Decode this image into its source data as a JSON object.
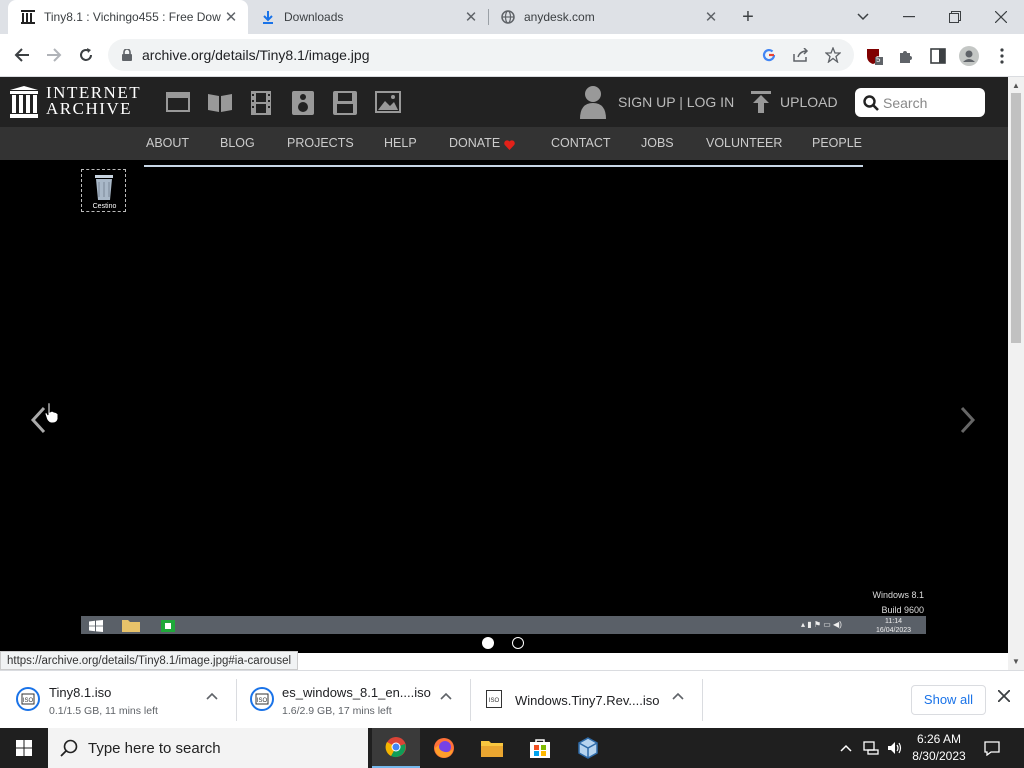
{
  "browser": {
    "tabs": [
      {
        "title": "Tiny8.1 : Vichingo455 : Free Dow",
        "icon": "internet-archive-icon",
        "active": true
      },
      {
        "title": "Downloads",
        "icon": "download-icon",
        "active": false
      },
      {
        "title": "anydesk.com",
        "icon": "globe-icon",
        "active": false
      }
    ],
    "new_tab_label": "+",
    "url": "archive.org/details/Tiny8.1/image.jpg",
    "extension_badge": "5",
    "status_url": "https://archive.org/details/Tiny8.1/image.jpg#ia-carousel"
  },
  "archive": {
    "logo_line1": "INTERNET",
    "logo_line2": "ARCHIVE",
    "signup": "SIGN UP | LOG IN",
    "upload": "UPLOAD",
    "search_placeholder": "Search",
    "nav": [
      "ABOUT",
      "BLOG",
      "PROJECTS",
      "HELP",
      "DONATE",
      "CONTACT",
      "JOBS",
      "VOLUNTEER",
      "PEOPLE"
    ]
  },
  "viewer": {
    "recycle_label": "Cestino",
    "watermark_line1": "Windows 8.1",
    "watermark_line2": "Build 9600",
    "inner_clock_time": "11:14",
    "inner_clock_date": "16/04/2023",
    "carousel_active_index": 0,
    "carousel_count": 2
  },
  "downloads": [
    {
      "name": "Tiny8.1.iso",
      "info": "0.1/1.5 GB, 11 mins left"
    },
    {
      "name": "es_windows_8.1_en....iso",
      "info": "1.6/2.9 GB, 17 mins left"
    },
    {
      "name": "Windows.Tiny7.Rev....iso",
      "info": ""
    }
  ],
  "shelf": {
    "show_all": "Show all"
  },
  "taskbar": {
    "search_placeholder": "Type here to search",
    "time": "6:26 AM",
    "date": "8/30/2023"
  }
}
